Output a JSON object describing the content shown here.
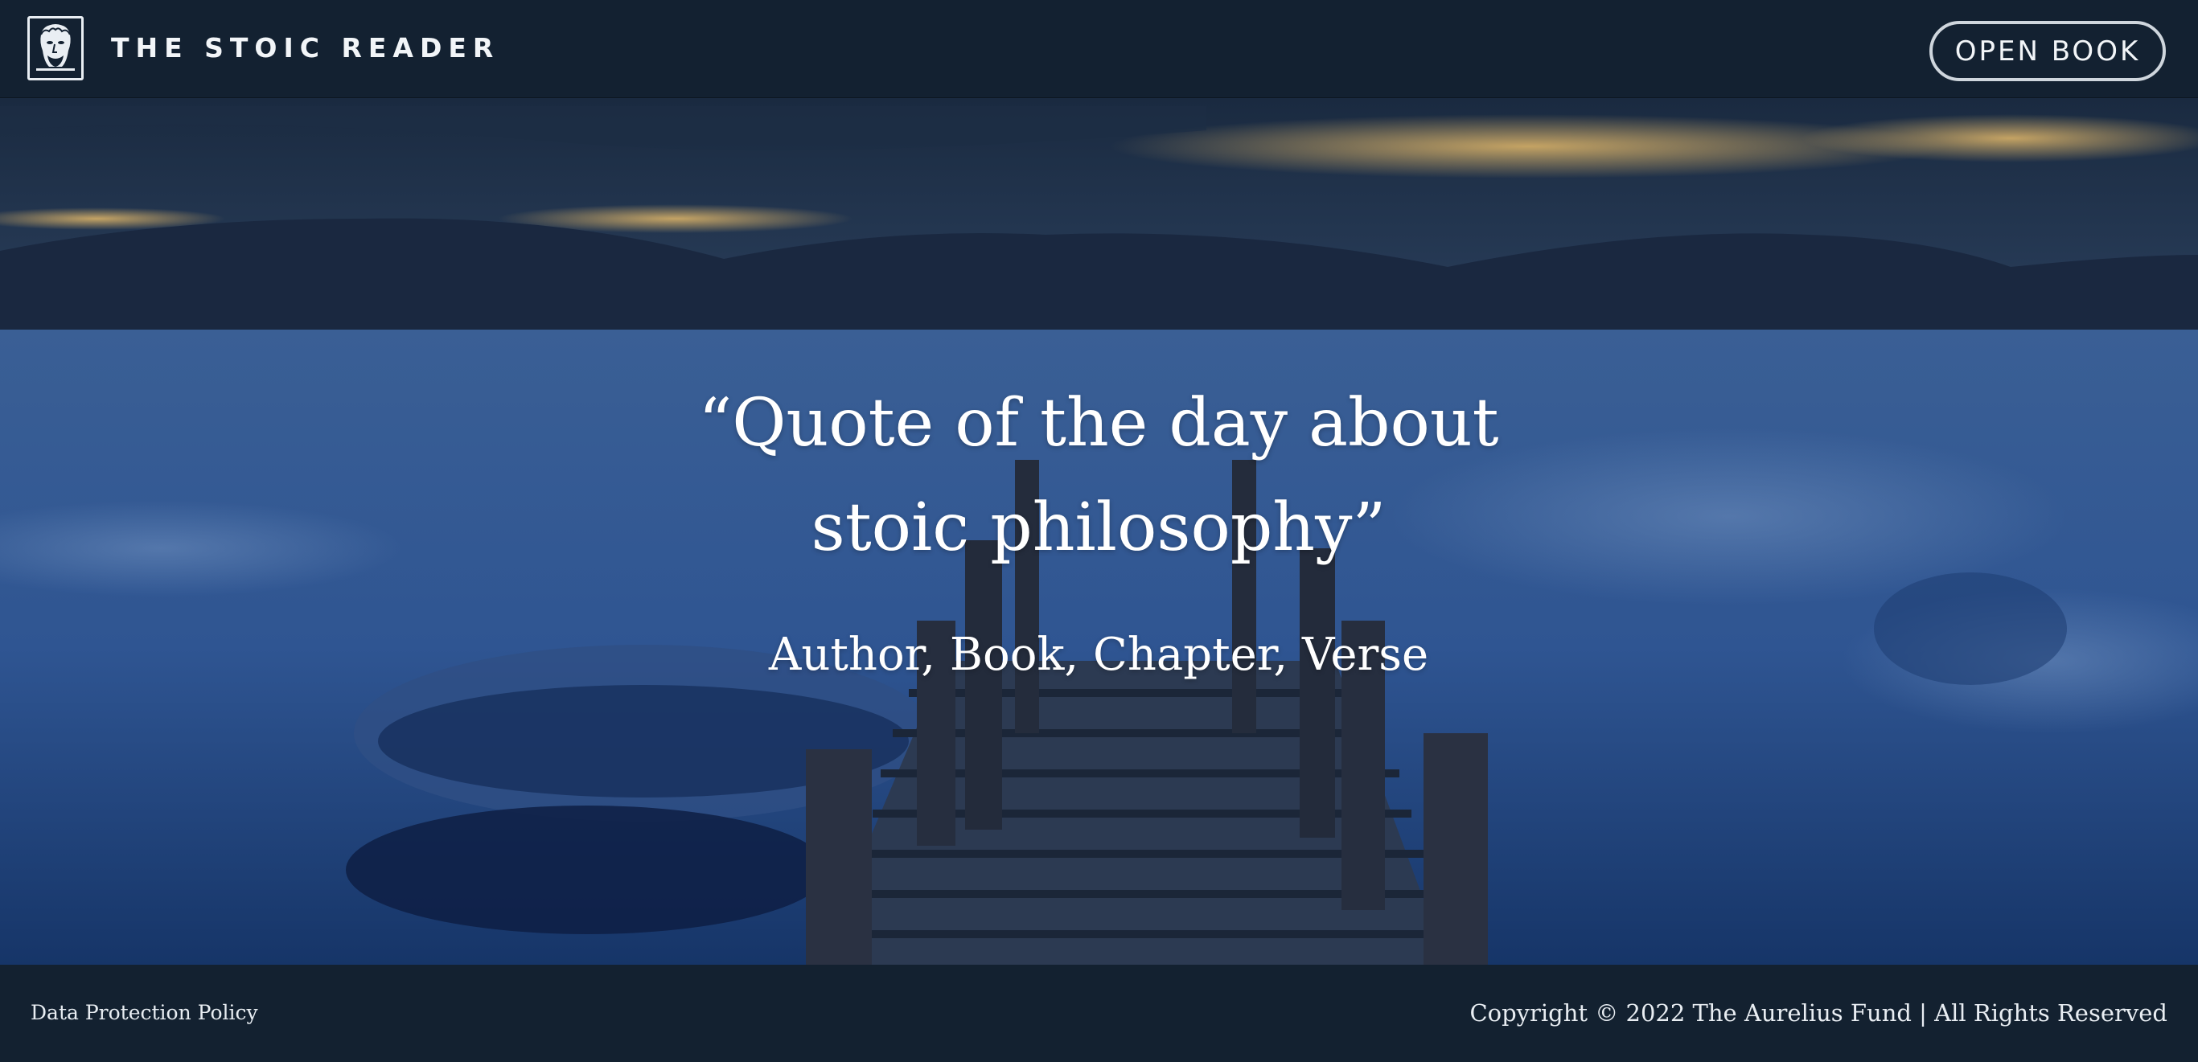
{
  "header": {
    "brand": "THE STOIC READER",
    "logo_icon": "stoic-bust-icon",
    "open_book_label": "OPEN BOOK"
  },
  "hero": {
    "background_image": "lake-pier-boat-dusk",
    "quote_line1": "“Quote of the day about",
    "quote_line2": "stoic philosophy”",
    "citation": "Author, Book, Chapter, Verse"
  },
  "footer": {
    "policy_link": "Data Protection Policy",
    "copyright": "Copyright © 2022 The Aurelius Fund | All Rights Reserved"
  },
  "colors": {
    "header_bg": "#132131",
    "footer_bg": "#132130",
    "text": "#ffffff",
    "button_border": "#cfd6dd"
  }
}
